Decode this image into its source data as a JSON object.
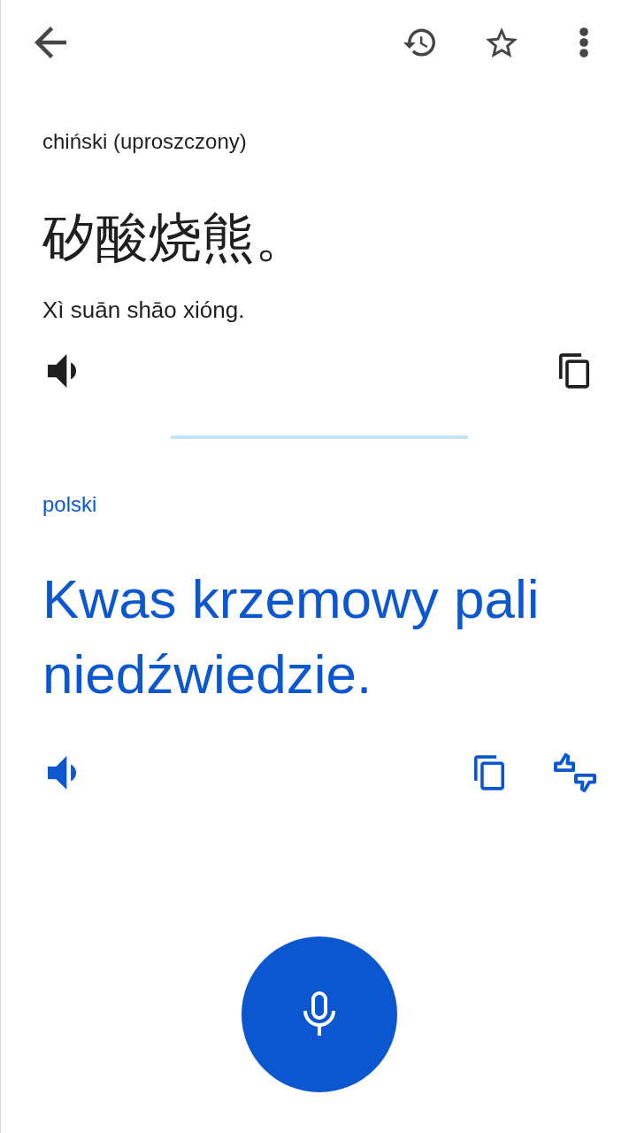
{
  "source": {
    "language": "chiński (uproszczony)",
    "text": "矽酸烧熊。",
    "transliteration": "Xì suān shāo xióng."
  },
  "target": {
    "language": "polski",
    "text": "Kwas krzemowy pali niedźwiedzie."
  }
}
